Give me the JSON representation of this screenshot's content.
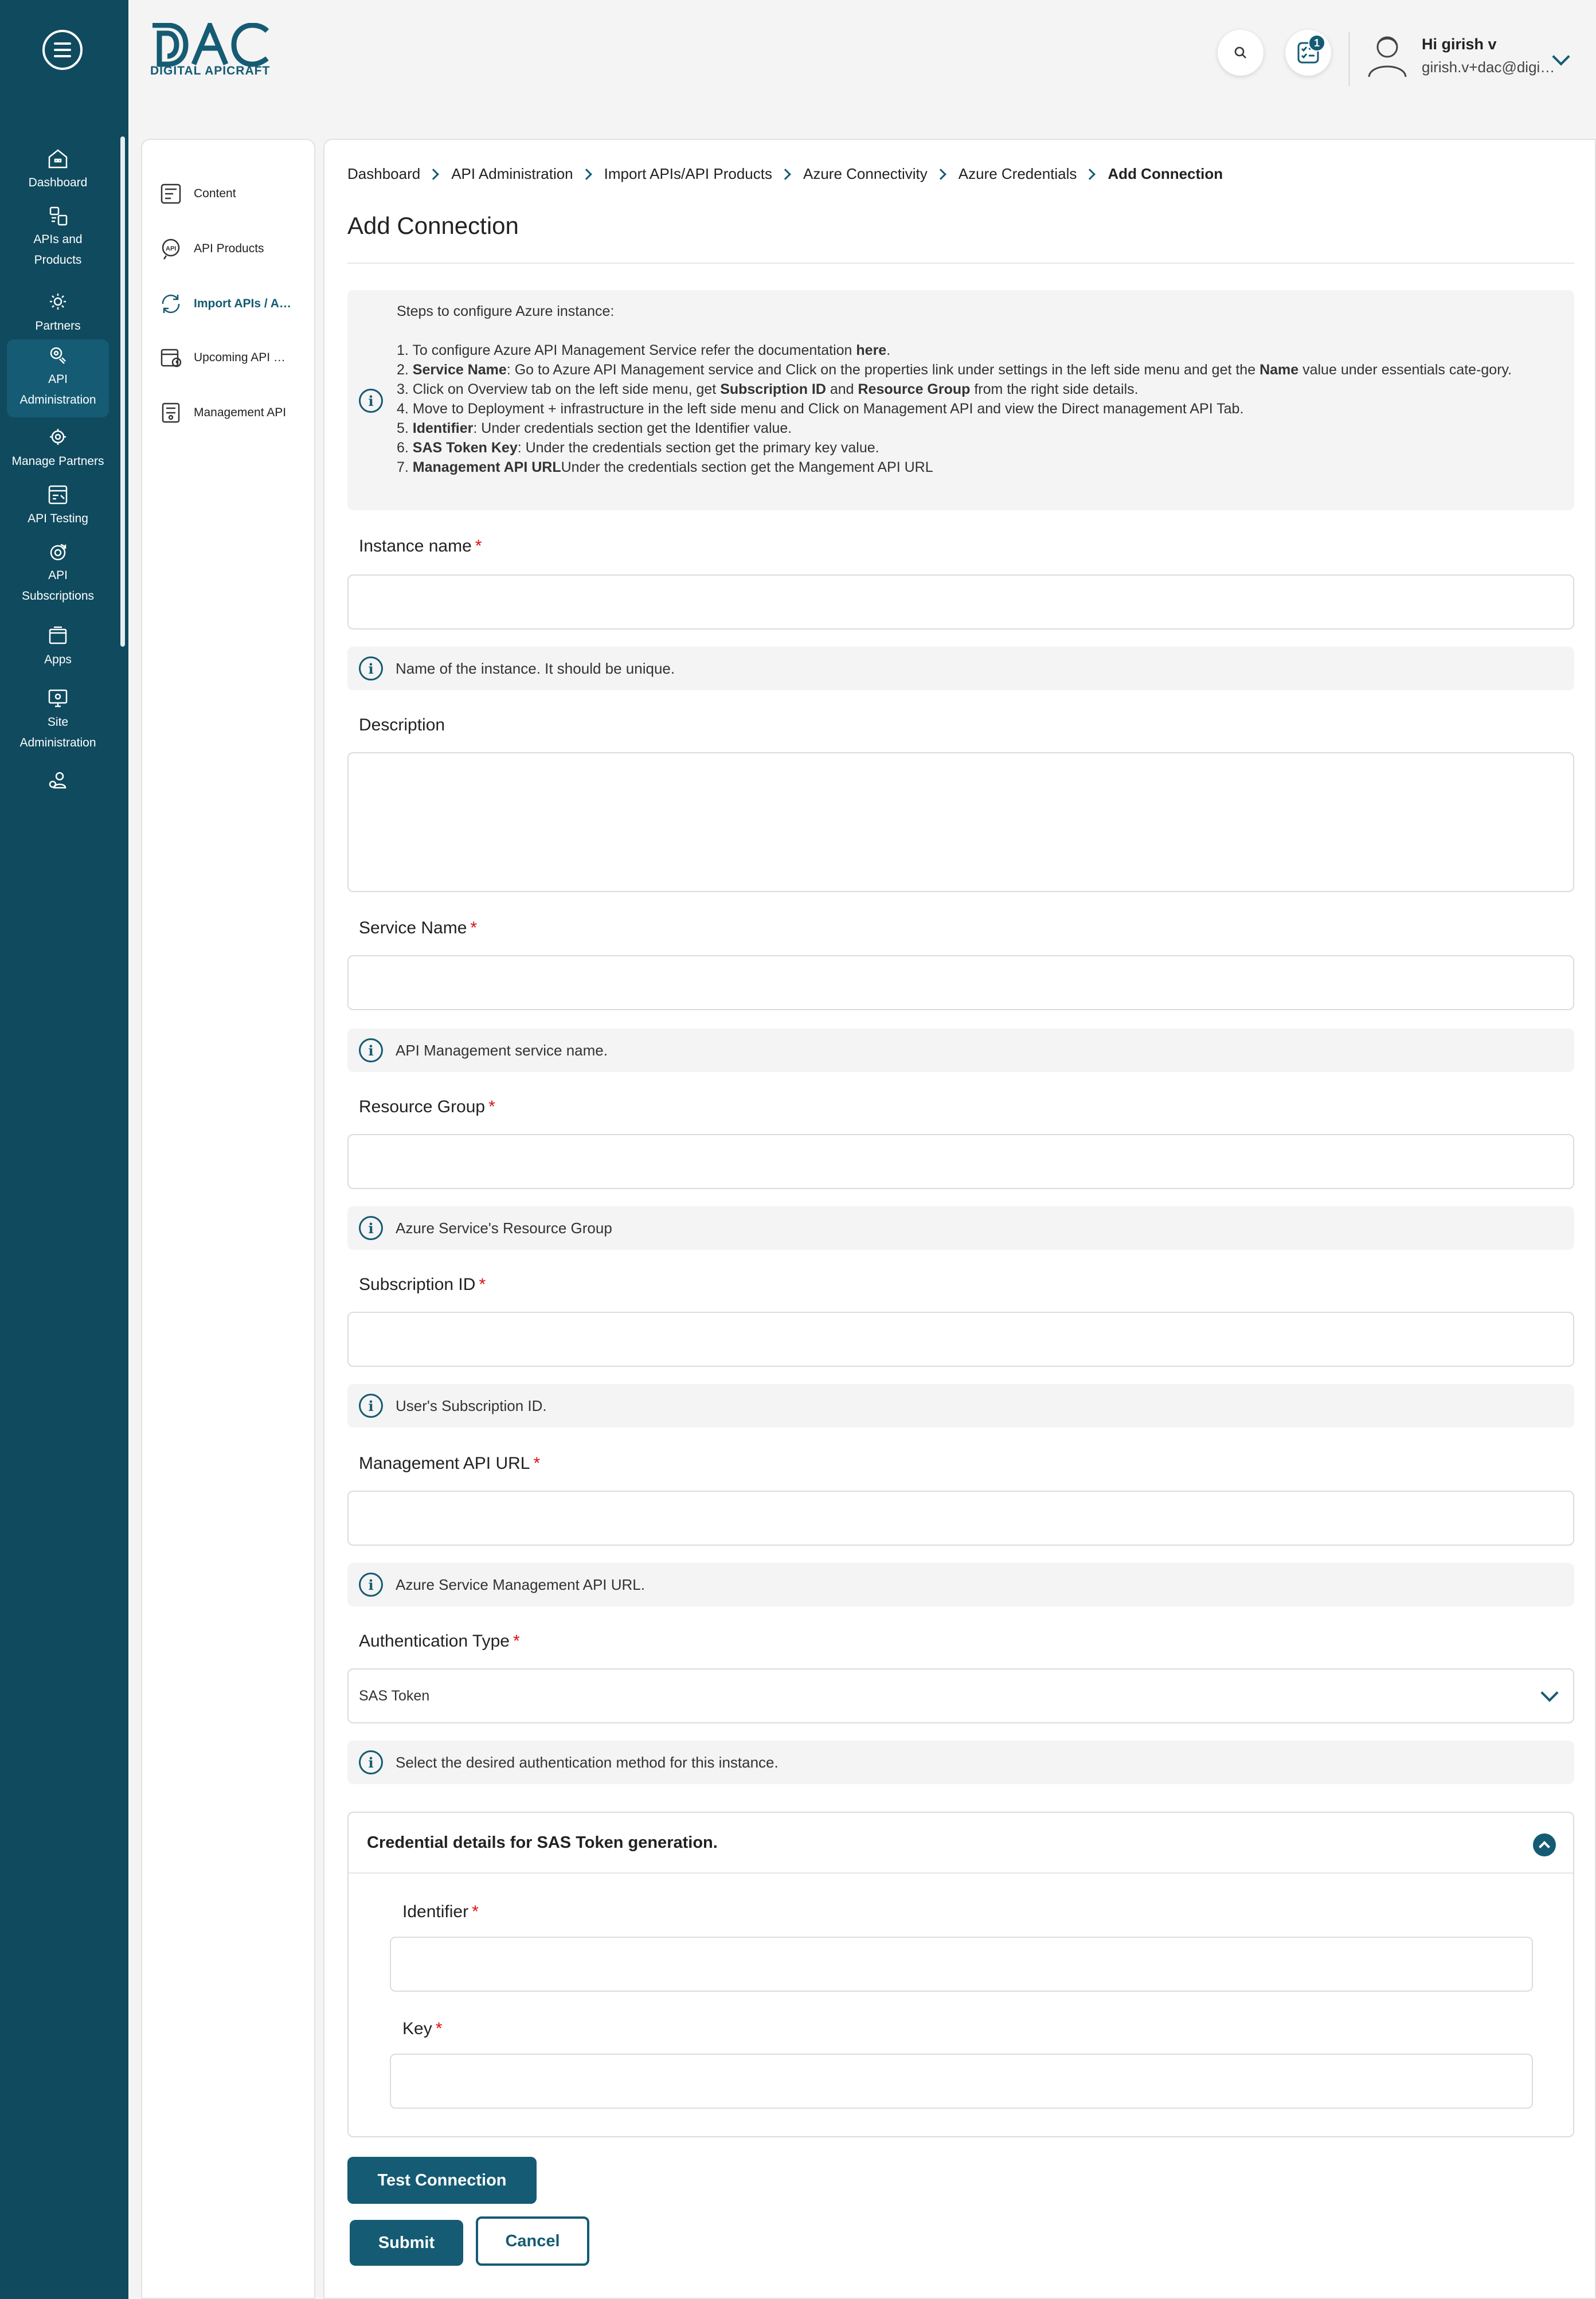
{
  "app": {
    "logo_mark": "DAC",
    "logo_text": "DIGITAL APICRAFT",
    "notification_count": "1",
    "user_greeting": "Hi girish v",
    "user_email": "girish.v+dac@digital-apicraft.com",
    "accent_color": "#155b73",
    "rail_color": "#0f4a5e"
  },
  "rail": {
    "items": [
      {
        "label": "Dashboard",
        "icon": "dashboard-icon"
      },
      {
        "label": "APIs and Products",
        "icon": "apis-products-icon"
      },
      {
        "label": "Partners",
        "icon": "partners-icon"
      },
      {
        "label": "API Administration",
        "icon": "api-administration-icon",
        "active": true
      },
      {
        "label": "Manage Partners",
        "icon": "manage-partners-icon"
      },
      {
        "label": "API Testing",
        "icon": "api-testing-icon"
      },
      {
        "label": "API Subscriptions",
        "icon": "api-subscriptions-icon"
      },
      {
        "label": "Apps",
        "icon": "apps-icon"
      },
      {
        "label": "Site Administration",
        "icon": "site-administration-icon"
      }
    ]
  },
  "subnav": {
    "items": [
      {
        "label": "Content",
        "icon": "content-icon"
      },
      {
        "label": "API Products",
        "icon": "api-products-icon"
      },
      {
        "label": "Import APIs / API Products",
        "icon": "import-apis-icon",
        "active": true
      },
      {
        "label": "Upcoming API Products",
        "icon": "upcoming-api-icon"
      },
      {
        "label": "Management API",
        "icon": "management-api-icon"
      }
    ]
  },
  "breadcrumb": {
    "items": [
      "Dashboard",
      "API Administration",
      "Import APIs/API Products",
      "Azure Connectivity",
      "Azure Credentials"
    ],
    "current": "Add Connection"
  },
  "page": {
    "title": "Add Connection"
  },
  "steps": {
    "heading": "Steps to configure Azure instance:",
    "s1_a": "1. To configure Azure API Management Service refer the documentation ",
    "s1_link": "here",
    "s1_b": ".",
    "s2_num": "2. ",
    "s2_bold": "Service Name",
    "s2_a": ": Go to Azure API Management service and Click on the properties link under settings in the left side menu and get the ",
    "s2_bold2": "Name",
    "s2_b": " value under essentials cate-gory.",
    "s3_a": "3. Click on Overview tab on the left side menu, get ",
    "s3_bold": "Subscription ID",
    "s3_mid": " and ",
    "s3_bold2": "Resource Group",
    "s3_b": " from the right side details.",
    "s4": "4. Move to Deployment + infrastructure in the left side menu and Click on Management API and view the Direct management API Tab.",
    "s5_num": "5. ",
    "s5_bold": "Identifier",
    "s5_a": ": Under credentials section get the Identifier value.",
    "s6_num": "6. ",
    "s6_bold": "SAS Token Key",
    "s6_a": ": Under the credentials section get the primary key value.",
    "s7_num": "7. ",
    "s7_bold": "Management API URL",
    "s7_a": "Under the credentials section get the Mangement API URL"
  },
  "form": {
    "instance_name": {
      "label": "Instance name",
      "required": "*",
      "value": "",
      "hint": "Name of the instance. It should be unique."
    },
    "description": {
      "label": "Description",
      "value": ""
    },
    "service_name": {
      "label": "Service Name",
      "required": "*",
      "value": "",
      "hint": "API Management service name."
    },
    "resource_group": {
      "label": "Resource Group",
      "required": "*",
      "value": "",
      "hint": "Azure Service's Resource Group"
    },
    "subscription_id": {
      "label": "Subscription ID",
      "required": "*",
      "value": "",
      "hint": "User's Subscription ID."
    },
    "management_api_url": {
      "label": "Management API URL",
      "required": "*",
      "value": "",
      "hint": "Azure Service Management API URL."
    },
    "authentication_type": {
      "label": "Authentication Type",
      "required": "*",
      "selected": "SAS Token",
      "hint": "Select the desired authentication method for this instance."
    },
    "credentials": {
      "title": "Credential details for SAS Token generation.",
      "identifier": {
        "label": "Identifier",
        "required": "*",
        "value": ""
      },
      "key": {
        "label": "Key",
        "required": "*",
        "value": ""
      }
    }
  },
  "actions": {
    "test_connection": "Test Connection",
    "submit": "Submit",
    "cancel": "Cancel"
  }
}
